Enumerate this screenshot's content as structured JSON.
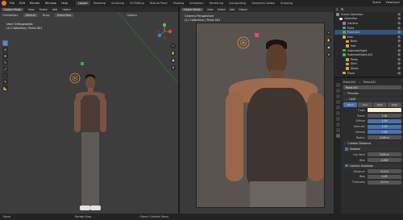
{
  "topbar": {
    "menu": [
      "File",
      "Edit",
      "Render",
      "Window",
      "Help"
    ],
    "workspaces": [
      "Layout",
      "Modeling",
      "Sculpting",
      "UV Editing",
      "Texture Paint",
      "Shading",
      "Animation",
      "Rendering",
      "Compositing",
      "Geometry Nodes",
      "Scripting"
    ],
    "active_workspace": "Layout",
    "scene": "Scene",
    "viewlayer": "ViewLayer"
  },
  "viewport1": {
    "mode": "Object Mode",
    "menus": [
      "View",
      "Select",
      "Add",
      "Object"
    ],
    "orientation_label": "Orientation:",
    "orientation": "Default",
    "drag_label": "Drag:",
    "drag": "Select Box",
    "options": "Options",
    "info_title": "User Orthographic",
    "info_collection": "(1) Collection | Point.001"
  },
  "viewport2": {
    "mode": "Object Mode",
    "menus": [
      "View",
      "Select",
      "Add",
      "Object"
    ],
    "info_title": "Camera Perspective",
    "info_collection": "(1) Collection | Point.001"
  },
  "outliner": {
    "items": [
      {
        "label": "Scene Collection",
        "color": "#8a8a8a",
        "selected": false
      },
      {
        "label": "Collection",
        "color": "#e0e0e0",
        "selected": false
      },
      {
        "label": "Camera",
        "color": "#9b6fd1",
        "selected": false
      },
      {
        "label": "Point",
        "color": "#4ab04a",
        "selected": false
      },
      {
        "label": "Point.001",
        "color": "#4ab04a",
        "selected": true
      },
      {
        "label": "man",
        "color": "#e8a03b",
        "selected": false
      },
      {
        "label": "Body",
        "color": "#e8a03b",
        "selected": false
      },
      {
        "label": "Hair",
        "color": "#e8a03b",
        "selected": false
      },
      {
        "label": "SubmeshNight",
        "color": "#4ab04a",
        "selected": false
      },
      {
        "label": "SubmeshNight.001",
        "color": "#4ab04a",
        "selected": false
      },
      {
        "label": "Pants",
        "color": "#e8a03b",
        "selected": false
      },
      {
        "label": "Shirt",
        "color": "#e8a03b",
        "selected": false
      },
      {
        "label": "Shoes",
        "color": "#e8a03b",
        "selected": false
      },
      {
        "label": "Plane",
        "color": "#e8a03b",
        "selected": false
      }
    ]
  },
  "properties": {
    "breadcrumb_obj": "Point.001",
    "breadcrumb_data": "Point.001",
    "datablock": "Point.001",
    "preview": "Preview",
    "light": "Light",
    "light_types": [
      "Point",
      "Sun",
      "Spot",
      "Area"
    ],
    "active_light_type": "Point",
    "rows": [
      {
        "label": "Color",
        "value": "",
        "kind": "swatch"
      },
      {
        "label": "Power",
        "value": "5 W",
        "kind": "plain"
      },
      {
        "label": "Diffuse",
        "value": "1.00",
        "kind": "blue"
      },
      {
        "label": "Specular",
        "value": "1.00",
        "kind": "blue"
      },
      {
        "label": "Volume",
        "value": "1.00",
        "kind": "blue"
      },
      {
        "label": "Radius",
        "value": "0.08 m",
        "kind": "plain"
      }
    ],
    "custom_distance": "Custom Distance",
    "shadow": "Shadow",
    "shadow_rows": [
      {
        "label": "Clip Start",
        "value": "0.05 m"
      },
      {
        "label": "Bias",
        "value": "1.000"
      }
    ],
    "contact_shadows": "Contact Shadows",
    "contact_rows": [
      {
        "label": "Distance",
        "value": "0.2 m"
      },
      {
        "label": "Bias",
        "value": "0.03"
      },
      {
        "label": "Thickness",
        "value": "0.2 m"
      }
    ]
  },
  "status": {
    "left": "Move",
    "mid": "Rotate View",
    "right": "Object Context Menu"
  }
}
